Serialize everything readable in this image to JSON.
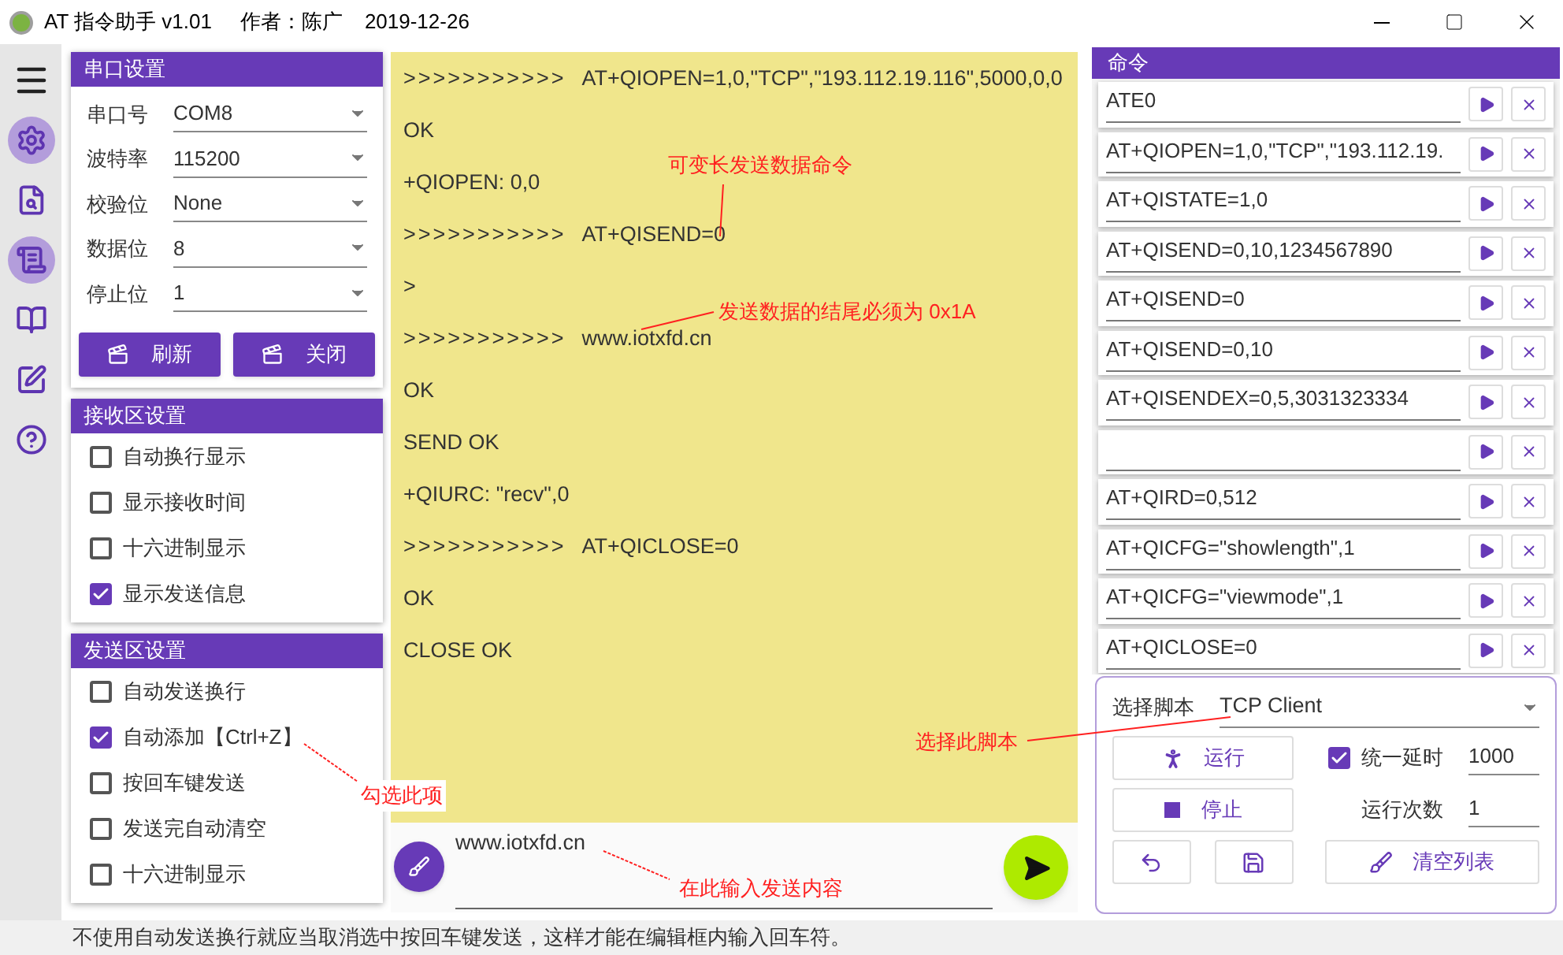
{
  "window": {
    "title": "AT 指令助手 v1.01",
    "author": "作者：陈广",
    "date": "2019-12-26"
  },
  "sidebar": {
    "items": [
      {
        "kind": "menu",
        "highlighted": false
      },
      {
        "kind": "settings",
        "highlighted": true
      },
      {
        "kind": "file-search",
        "highlighted": false
      },
      {
        "kind": "script",
        "highlighted": true
      },
      {
        "kind": "book",
        "highlighted": false
      },
      {
        "kind": "table-edit",
        "highlighted": false
      },
      {
        "kind": "help",
        "highlighted": false
      }
    ]
  },
  "serial_settings": {
    "title": "串口设置",
    "fields": [
      {
        "label": "串口号",
        "value": "COM8"
      },
      {
        "label": "波特率",
        "value": "115200"
      },
      {
        "label": "校验位",
        "value": "None"
      },
      {
        "label": "数据位",
        "value": "8"
      },
      {
        "label": "停止位",
        "value": "1"
      }
    ],
    "buttons": [
      "刷新",
      "关闭"
    ]
  },
  "receive_settings": {
    "title": "接收区设置",
    "options": [
      {
        "label": "自动换行显示",
        "checked": false
      },
      {
        "label": "显示接收时间",
        "checked": false
      },
      {
        "label": "十六进制显示",
        "checked": false
      },
      {
        "label": "显示发送信息",
        "checked": true
      }
    ]
  },
  "send_settings": {
    "title": "发送区设置",
    "options": [
      {
        "label": "自动发送换行",
        "checked": false
      },
      {
        "label": "自动添加【Ctrl+Z】",
        "checked": true
      },
      {
        "label": "按回车键发送",
        "checked": false
      },
      {
        "label": "发送完自动清空",
        "checked": false
      },
      {
        "label": "十六进制显示",
        "checked": false
      }
    ]
  },
  "log": {
    "lines": [
      {
        "prefix": ">>>>>>>>>>>",
        "text": "AT+QIOPEN=1,0,\"TCP\",\"193.112.19.116\",5000,0,0"
      },
      {
        "text": "OK"
      },
      {
        "text": "+QIOPEN: 0,0"
      },
      {
        "prefix": ">>>>>>>>>>>",
        "text": "AT+QISEND=0"
      },
      {
        "text": ">"
      },
      {
        "prefix": ">>>>>>>>>>>",
        "text": "www.iotxfd.cn"
      },
      {
        "text": "OK"
      },
      {
        "text": "SEND OK"
      },
      {
        "text": "+QIURC: \"recv\",0"
      },
      {
        "prefix": ">>>>>>>>>>>",
        "text": "AT+QICLOSE=0"
      },
      {
        "text": "OK"
      },
      {
        "text": "CLOSE OK"
      }
    ]
  },
  "send_input": {
    "value": "www.iotxfd.cn"
  },
  "commands": {
    "title": "命令",
    "items": [
      {
        "kind": "command",
        "value": "ATE0"
      },
      {
        "kind": "command",
        "value": "AT+QIOPEN=1,0,\"TCP\",\"193.112.19."
      },
      {
        "kind": "command",
        "value": "AT+QISTATE=1,0"
      },
      {
        "kind": "command",
        "value": "AT+QISEND=0,10,1234567890"
      },
      {
        "kind": "command",
        "value": "AT+QISEND=0"
      },
      {
        "kind": "command",
        "value": "AT+QISEND=0,10"
      },
      {
        "kind": "command",
        "value": "AT+QISENDEX=0,5,3031323334"
      },
      {
        "kind": "blank"
      },
      {
        "kind": "command",
        "value": "AT+QIRD=0,512"
      },
      {
        "kind": "command",
        "value": "AT+QICFG=\"showlength\",1"
      },
      {
        "kind": "command",
        "value": "AT+QICFG=\"viewmode\",1"
      },
      {
        "kind": "command",
        "value": "AT+QICLOSE=0"
      }
    ]
  },
  "script": {
    "label": "选择脚本",
    "value": "TCP Client",
    "run": "运行",
    "stop": "停止",
    "delay": {
      "label": "统一延时",
      "checked": true,
      "value": "1000"
    },
    "run_count": {
      "label": "运行次数",
      "value": "1"
    },
    "clear": "清空列表"
  },
  "annotations": [
    {
      "text": "可变长发送数据命令"
    },
    {
      "text": "发送数据的结尾必须为 0x1A"
    },
    {
      "text": "勾选此项"
    },
    {
      "text": "选择此脚本"
    },
    {
      "text": "在此输入发送内容"
    }
  ],
  "status_bar": {
    "text": "不使用自动发送换行就应当取消选中按回车键发送，这样才能在编辑框内输入回车符。"
  }
}
